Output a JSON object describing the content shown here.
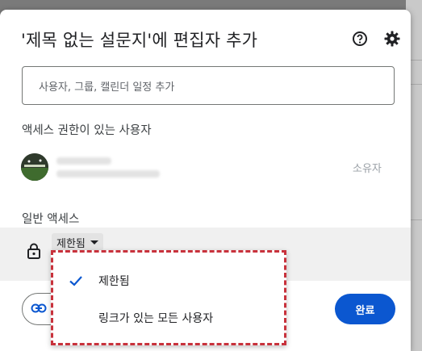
{
  "dialog": {
    "title": "'제목 없는 설문지'에 편집자 추가",
    "add_placeholder": "사용자, 그룹, 캘린더 일정 추가",
    "access_header": "액세스 권한이 있는 사용자",
    "owner_role": "소유자",
    "general_access_header": "일반 액세스",
    "general_access_value": "제한됨",
    "done_label": "완료",
    "icons": {
      "help": "help-circle-icon",
      "settings": "gear-icon",
      "lock": "lock-icon",
      "link": "link-icon",
      "check": "check-icon"
    }
  },
  "menu": {
    "items": [
      {
        "label": "제한됨",
        "selected": true
      },
      {
        "label": "링크가 있는 모든 사용자",
        "selected": false
      }
    ]
  },
  "colors": {
    "primary": "#0b57d0",
    "highlight_border": "#c8323c"
  }
}
